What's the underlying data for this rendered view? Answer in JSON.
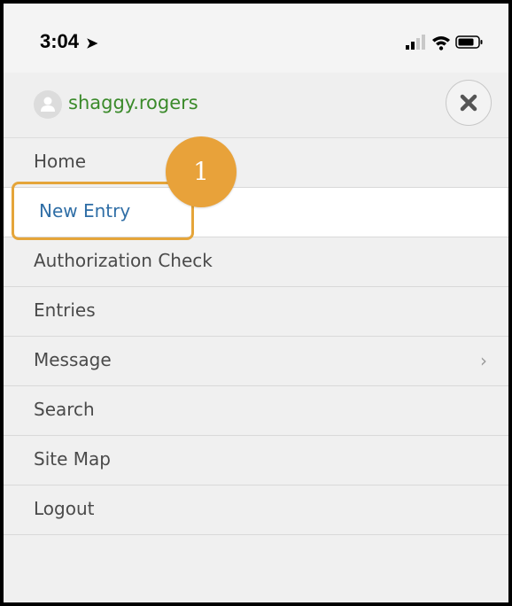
{
  "status_bar": {
    "time": "3:04",
    "location_icon": "location-arrow-icon",
    "icons": [
      "signal-icon",
      "wifi-icon",
      "battery-icon"
    ]
  },
  "user": {
    "name": "shaggy.rogers",
    "avatar_icon": "user-avatar-icon",
    "name_color": "#3a8a2a"
  },
  "close_icon": "close-icon",
  "menu": {
    "items": [
      {
        "label": "Home"
      },
      {
        "label": "New Entry",
        "active": true
      },
      {
        "label": "Authorization Check"
      },
      {
        "label": "Entries"
      },
      {
        "label": "Message",
        "has_submenu": true
      },
      {
        "label": "Search"
      },
      {
        "label": "Site Map"
      },
      {
        "label": "Logout"
      }
    ]
  },
  "annotation": {
    "step": "1",
    "color": "#e8a23a"
  },
  "colors": {
    "active_text": "#2f6ea6",
    "highlight_border": "#e5a53a"
  }
}
